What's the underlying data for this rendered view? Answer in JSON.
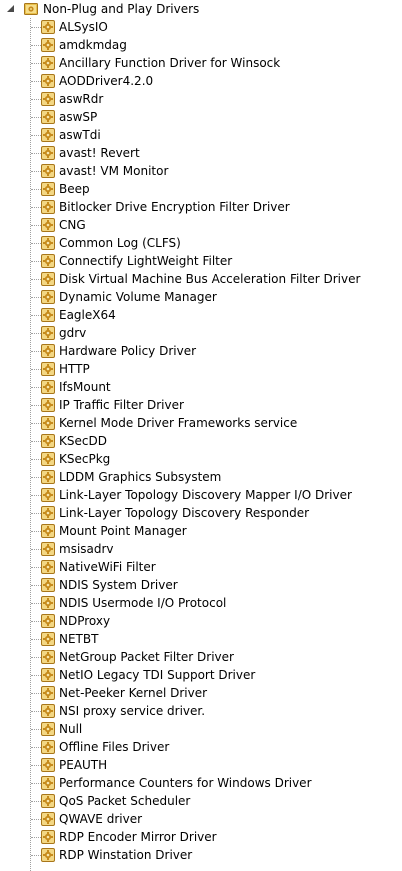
{
  "tree": {
    "root_label": "Non-Plug and Play Drivers",
    "items": [
      "ALSysIO",
      "amdkmdag",
      "Ancillary Function Driver for Winsock",
      "AODDriver4.2.0",
      "aswRdr",
      "aswSP",
      "aswTdi",
      "avast! Revert",
      "avast! VM Monitor",
      "Beep",
      "Bitlocker Drive Encryption Filter Driver",
      "CNG",
      "Common Log (CLFS)",
      "Connectify LightWeight Filter",
      "Disk Virtual Machine Bus Acceleration Filter Driver",
      "Dynamic Volume Manager",
      "EagleX64",
      "gdrv",
      "Hardware Policy Driver",
      "HTTP",
      "IfsMount",
      "IP Traffic Filter Driver",
      "Kernel Mode Driver Frameworks service",
      "KSecDD",
      "KSecPkg",
      "LDDM Graphics Subsystem",
      "Link-Layer Topology Discovery Mapper I/O Driver",
      "Link-Layer Topology Discovery Responder",
      "Mount Point Manager",
      "msisadrv",
      "NativeWiFi Filter",
      "NDIS System Driver",
      "NDIS Usermode I/O Protocol",
      "NDProxy",
      "NETBT",
      "NetGroup Packet Filter Driver",
      "NetIO Legacy TDI Support Driver",
      "Net-Peeker Kernel Driver",
      "NSI proxy service driver.",
      "Null",
      "Offline Files Driver",
      "PEAUTH",
      "Performance Counters for Windows Driver",
      "QoS Packet Scheduler",
      "QWAVE driver",
      "RDP Encoder Mirror Driver",
      "RDP Winstation Driver"
    ]
  },
  "icons": {
    "expander": "collapse-triangle-icon",
    "root": "driver-folder-icon",
    "item": "device-driver-icon"
  },
  "colors": {
    "icon_gold": "#d9a32a",
    "icon_gold_dark": "#a8761a",
    "guide_line": "#a0a0a0"
  }
}
